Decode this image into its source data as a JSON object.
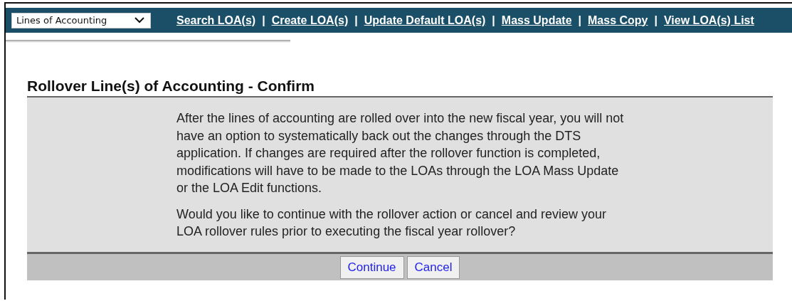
{
  "nav": {
    "module_select": {
      "value": "Lines of Accounting"
    },
    "links": [
      "Search LOA(s)",
      "Create LOA(s)",
      "Update Default LOA(s)",
      "Mass Update",
      "Mass Copy",
      "View LOA(s) List"
    ],
    "separator": "|"
  },
  "page": {
    "title": "Rollover Line(s) of Accounting - Confirm",
    "paragraphs": [
      "After the lines of accounting are rolled over into the new fiscal year, you will not have an option to systematically back out the changes through the DTS application. If changes are required after the rollover function is completed, modifications will have to be made to the LOAs through the LOA Mass Update or the LOA Edit functions.",
      "Would you like to continue with the rollover action or cancel and review your LOA rollover rules prior to executing the fiscal year rollover?"
    ],
    "buttons": [
      "Continue",
      "Cancel"
    ]
  }
}
